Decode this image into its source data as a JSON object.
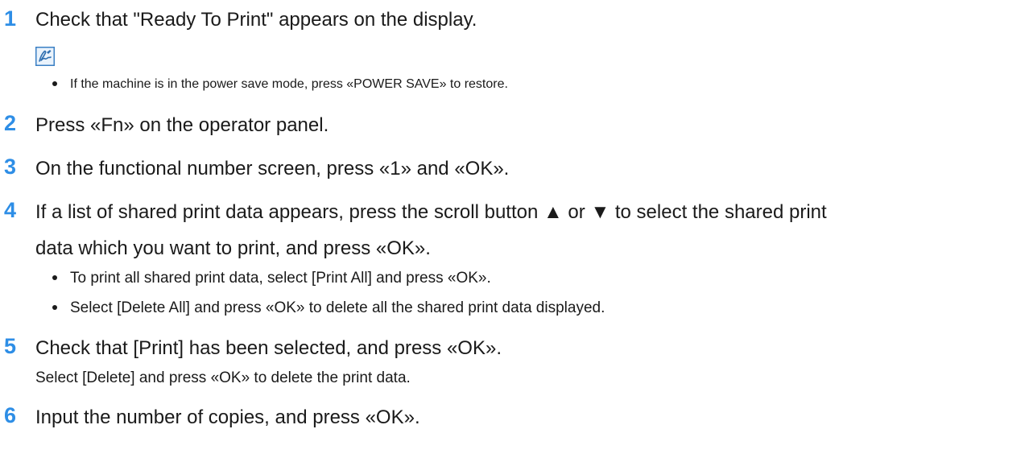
{
  "steps": [
    {
      "number": "1",
      "text": "Check that \"Ready To Print\" appears on the display.",
      "memo_icon": "memo-pen-icon",
      "bullets": [
        "If the machine is in the power save mode, press «POWER SAVE» to restore."
      ]
    },
    {
      "number": "2",
      "text": "Press «Fn» on the operator panel."
    },
    {
      "number": "3",
      "text": "On the functional number screen, press «1» and «OK»."
    },
    {
      "number": "4",
      "text_line1": "If a list of shared print data appears, press the scroll button ▲ or ▼ to select the shared print",
      "text_line2": "data which you want to print, and press «OK».",
      "bullets": [
        "To print all shared print data, select [Print All] and press «OK».",
        "Select [Delete All] and press «OK» to delete all the shared print data displayed."
      ]
    },
    {
      "number": "5",
      "text": "Check that [Print] has been selected, and press «OK».",
      "subtext": "Select [Delete] and press «OK» to delete the print data."
    },
    {
      "number": "6",
      "text": "Input the number of copies, and press «OK»."
    }
  ],
  "colors": {
    "step_number": "#2e8ee6",
    "text": "#1a1a1a",
    "memo_icon_border": "#3a7fc4"
  }
}
